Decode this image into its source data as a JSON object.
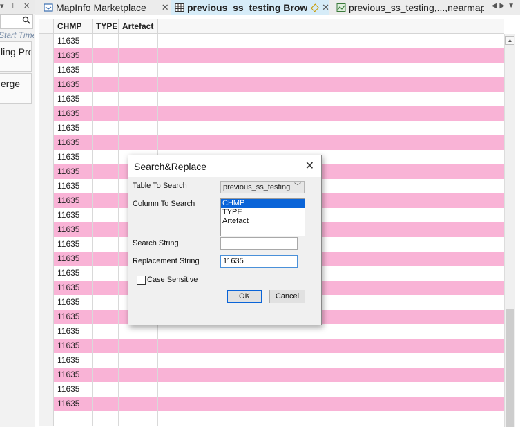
{
  "left_panel": {
    "start_time_label": "Start Time",
    "items": [
      {
        "label": "ling Pro"
      },
      {
        "label": "erge"
      }
    ]
  },
  "tabs": [
    {
      "label": "MapInfo Marketplace",
      "icon": "marketplace-icon",
      "active": false
    },
    {
      "label": "previous_ss_testing Browser",
      "icon": "table-grid-icon",
      "active": true
    },
    {
      "label": "previous_ss_testing,...,nearmap_clip",
      "icon": "map-window-icon",
      "active": false
    }
  ],
  "browser": {
    "columns": [
      "CHMP",
      "TYPE",
      "Artefact"
    ],
    "rows": [
      "11635",
      "11635",
      "11635",
      "11635",
      "11635",
      "11635",
      "11635",
      "11635",
      "11635",
      "11635",
      "11635",
      "11635",
      "11635",
      "11635",
      "11635",
      "11635",
      "11635",
      "11635",
      "11635",
      "11635",
      "11635",
      "11635",
      "11635",
      "11635",
      "11635",
      "11635",
      ""
    ]
  },
  "dialog": {
    "title": "Search&Replace",
    "table_label": "Table To Search",
    "table_value": "previous_ss_testing",
    "column_label": "Column To Search",
    "column_options": [
      "CHMP",
      "TYPE",
      "Artefact"
    ],
    "column_selected": "CHMP",
    "search_label": "Search String",
    "search_value": "",
    "replace_label": "Replacement String",
    "replace_value": "11635",
    "case_label": "Case Sensitive",
    "case_checked": false,
    "ok_label": "OK",
    "cancel_label": "Cancel"
  },
  "colors": {
    "row_highlight": "#f9b3d6",
    "active_tab": "#d6ecf8",
    "list_selection": "#0a64d8"
  }
}
